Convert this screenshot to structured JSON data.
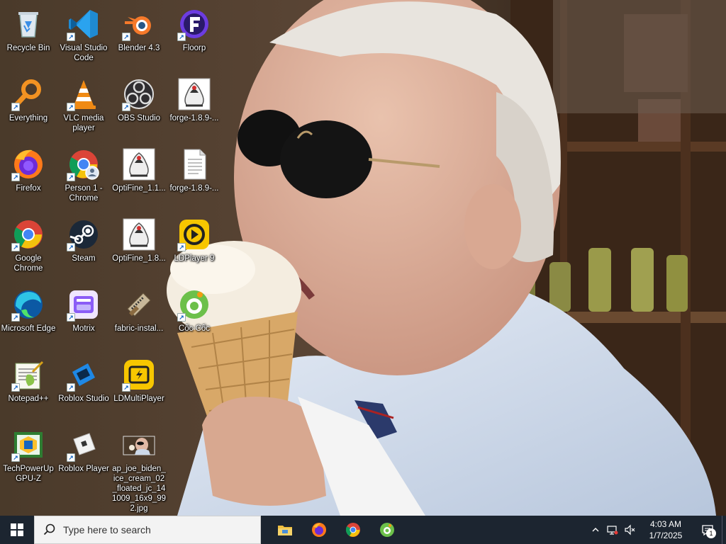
{
  "desktop": {
    "icons": [
      {
        "label": "Recycle Bin",
        "icon": "recycle-bin-icon",
        "shortcut": false
      },
      {
        "label": "Visual Studio Code",
        "icon": "vscode-icon",
        "shortcut": true
      },
      {
        "label": "Blender 4.3",
        "icon": "blender-icon",
        "shortcut": true
      },
      {
        "label": "Floorp",
        "icon": "floorp-icon",
        "shortcut": true
      },
      {
        "label": "Everything",
        "icon": "everything-search-icon",
        "shortcut": true
      },
      {
        "label": "VLC media player",
        "icon": "vlc-icon",
        "shortcut": true
      },
      {
        "label": "OBS Studio",
        "icon": "obs-icon",
        "shortcut": true
      },
      {
        "label": "forge-1.8.9-...",
        "icon": "java-jar-icon",
        "shortcut": false
      },
      {
        "label": "Firefox",
        "icon": "firefox-icon",
        "shortcut": true
      },
      {
        "label": "Person 1 - Chrome",
        "icon": "chrome-profile-icon",
        "shortcut": true
      },
      {
        "label": "OptiFine_1.1...",
        "icon": "java-jar-icon",
        "shortcut": false
      },
      {
        "label": "forge-1.8.9-...",
        "icon": "text-file-icon",
        "shortcut": false
      },
      {
        "label": "Google Chrome",
        "icon": "chrome-icon",
        "shortcut": true
      },
      {
        "label": "Steam",
        "icon": "steam-icon",
        "shortcut": true
      },
      {
        "label": "OptiFine_1.8...",
        "icon": "java-jar-icon",
        "shortcut": false
      },
      {
        "label": "LDPlayer 9",
        "icon": "ldplayer-icon",
        "shortcut": true
      },
      {
        "label": "Microsoft Edge",
        "icon": "edge-icon",
        "shortcut": true
      },
      {
        "label": "Motrix",
        "icon": "motrix-icon",
        "shortcut": true
      },
      {
        "label": "fabric-instal...",
        "icon": "installer-icon",
        "shortcut": false
      },
      {
        "label": "Cốc Cốc",
        "icon": "coccoc-icon",
        "shortcut": true
      },
      {
        "label": "Notepad++",
        "icon": "notepadpp-icon",
        "shortcut": true
      },
      {
        "label": "Roblox Studio",
        "icon": "roblox-studio-icon",
        "shortcut": true
      },
      {
        "label": "LDMultiPlayer",
        "icon": "ldmultiplayer-icon",
        "shortcut": true
      },
      {
        "label": "TechPowerUp GPU-Z",
        "icon": "gpuz-icon",
        "shortcut": true
      },
      {
        "label": "Roblox Player",
        "icon": "roblox-player-icon",
        "shortcut": true
      },
      {
        "label": "ap_joe_biden_ice_cream_02_floated_jc_141009_16x9_992.jpg",
        "icon": "image-thumbnail-icon",
        "shortcut": false
      }
    ]
  },
  "taskbar": {
    "search_placeholder": "Type here to search",
    "pinned": [
      {
        "name": "File Explorer",
        "icon": "file-explorer-icon"
      },
      {
        "name": "Firefox",
        "icon": "firefox-icon"
      },
      {
        "name": "Google Chrome",
        "icon": "chrome-icon"
      },
      {
        "name": "Cốc Cốc",
        "icon": "coccoc-icon"
      }
    ],
    "clock": {
      "time": "4:03 AM",
      "date": "1/7/2025"
    },
    "notification_count": "1"
  },
  "colors": {
    "taskbar_bg": "#1c2530",
    "search_bg": "#f3f3f3"
  }
}
